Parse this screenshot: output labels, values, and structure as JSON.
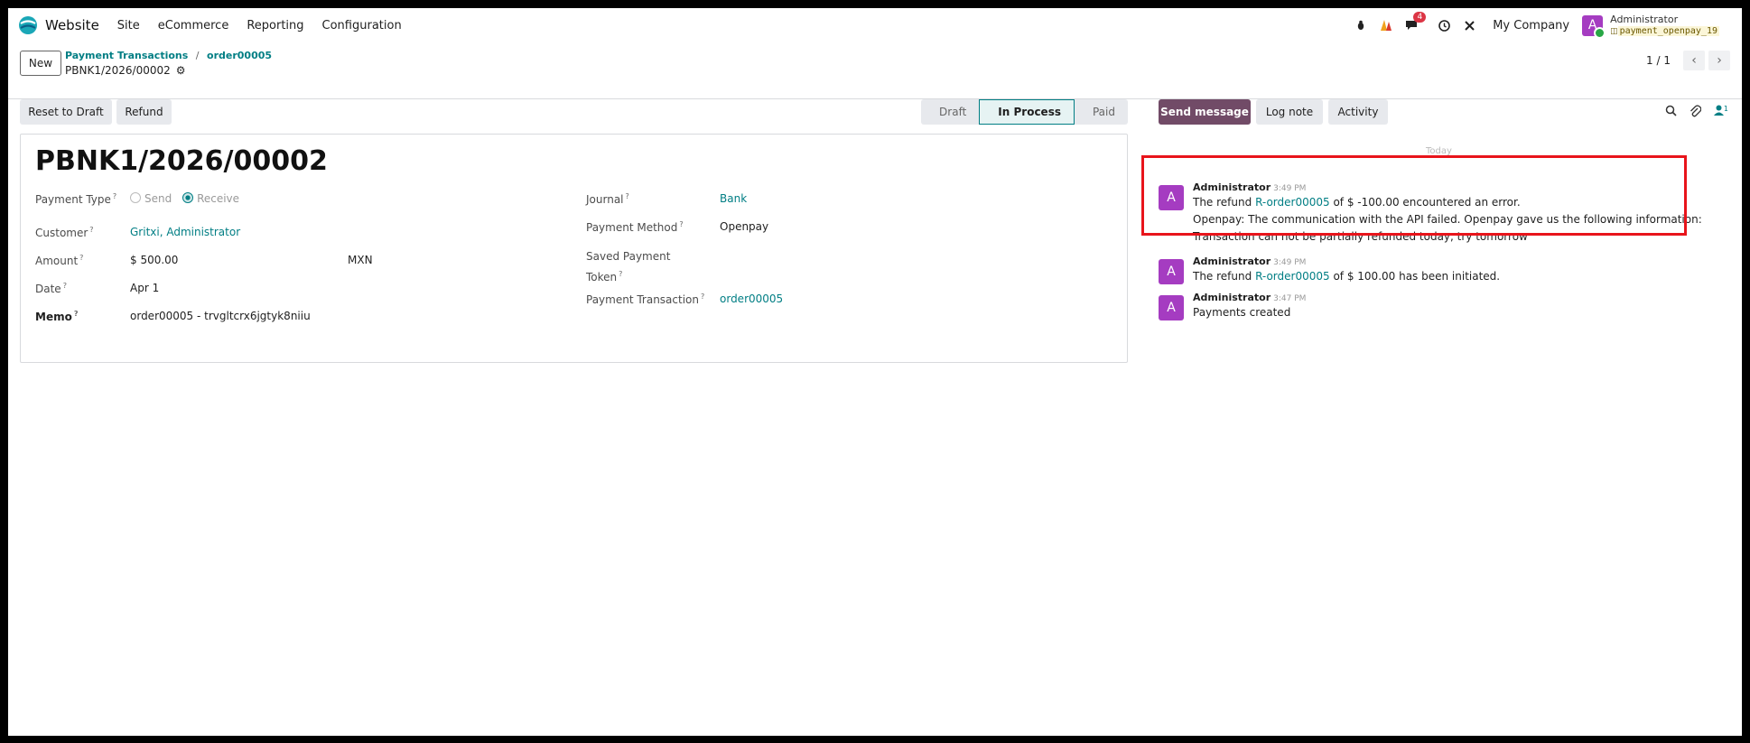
{
  "navbar": {
    "app_name": "Website",
    "menu": [
      "Site",
      "eCommerce",
      "Reporting",
      "Configuration"
    ],
    "messages_badge": "4",
    "company": "My Company",
    "user_initial": "A",
    "user_name": "Administrator",
    "db_name": "payment_openpay_19"
  },
  "control": {
    "new_label": "New",
    "breadcrumb_parent": "Payment Transactions",
    "breadcrumb_sep": "/",
    "breadcrumb_current": "order00005",
    "record_name": "PBNK1/2026/00002",
    "pager_value": "1 / 1"
  },
  "status_bar": {
    "reset_label": "Reset to Draft",
    "refund_label": "Refund",
    "stages": [
      "Draft",
      "In Process",
      "Paid"
    ],
    "active_stage": "In Process"
  },
  "form": {
    "title": "PBNK1/2026/00002",
    "payment_type_label": "Payment Type",
    "payment_type_send": "Send",
    "payment_type_receive": "Receive",
    "customer_label": "Customer",
    "customer_value": "Gritxi, Administrator",
    "amount_label": "Amount",
    "amount_value": "$ 500.00",
    "currency_value": "MXN",
    "date_label": "Date",
    "date_value": "Apr 1",
    "memo_label": "Memo",
    "memo_value": "order00005 - trvgltcrx6jgtyk8niiu",
    "journal_label": "Journal",
    "journal_value": "Bank",
    "payment_method_label": "Payment Method",
    "payment_method_value": "Openpay",
    "saved_token_label_1": "Saved Payment",
    "saved_token_label_2": "Token",
    "payment_tx_label": "Payment Transaction",
    "payment_tx_value": "order00005",
    "help_mark": "?"
  },
  "chatter": {
    "send_message_label": "Send message",
    "log_note_label": "Log note",
    "activity_label": "Activity",
    "followers_count": "1",
    "today_label": "Today",
    "messages": [
      {
        "author": "Administrator",
        "time": "3:49 PM",
        "line1_pre": "The refund ",
        "line1_link": "R-order00005",
        "line1_post": " of $ -100.00 encountered an error.",
        "line2": "Openpay: The communication with the API failed. Openpay gave us the following information:",
        "line3": "Transaction can not be partially refunded today, try tomorrow"
      },
      {
        "author": "Administrator",
        "time": "3:49 PM",
        "line1_pre": "The refund ",
        "line1_link": "R-order00005",
        "line1_post": " of $ 100.00 has been initiated."
      },
      {
        "author": "Administrator",
        "time": "3:47 PM",
        "line1_pre": "Payments created"
      }
    ]
  },
  "colors": {
    "accent": "#017e84",
    "primary_button": "#714b67",
    "avatar": "#a53cc1",
    "highlight_box": "#e8141b"
  }
}
